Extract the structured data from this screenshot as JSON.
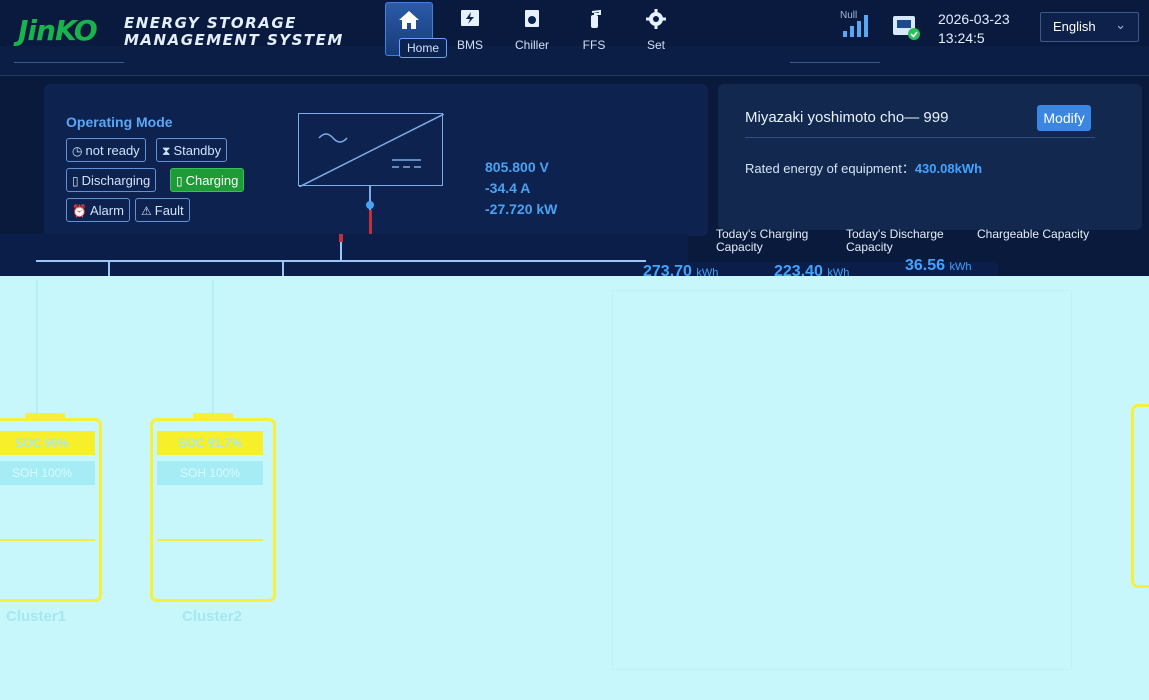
{
  "header": {
    "logo": "JinKO",
    "title_line1": "ENERGY STORAGE",
    "title_line2": "MANAGEMENT SYSTEM",
    "nav": [
      {
        "label": "Home",
        "icon": "home-icon",
        "active": true
      },
      {
        "label": "BMS",
        "icon": "bms-icon",
        "active": false
      },
      {
        "label": "Chiller",
        "icon": "chiller-icon",
        "active": false
      },
      {
        "label": "FFS",
        "icon": "fire-extinguisher-icon",
        "active": false
      },
      {
        "label": "Set",
        "icon": "gear-icon",
        "active": false
      }
    ],
    "signal_label": "Null",
    "date": "2026-03-23",
    "time": "13:24:5",
    "language": "English"
  },
  "operating": {
    "title": "Operating Mode",
    "modes": [
      {
        "label": "not ready",
        "icon": "clock-icon",
        "active": false
      },
      {
        "label": "Standby",
        "icon": "hourglass-icon",
        "active": false
      },
      {
        "label": "Discharging",
        "icon": "battery-discharge-icon",
        "active": false
      },
      {
        "label": "Charging",
        "icon": "battery-charge-icon",
        "active": true
      },
      {
        "label": "Alarm",
        "icon": "alarm-icon",
        "active": false
      },
      {
        "label": "Fault",
        "icon": "warning-icon",
        "active": false
      }
    ],
    "voltage": "805.800 V",
    "current": "-34.4 A",
    "power": "-27.720 kW"
  },
  "station": {
    "name": "Miyazaki yoshimoto cho— 999",
    "modify_label": "Modify",
    "rated_label": "Rated energy of equipment：",
    "rated_value": "430.08kWh",
    "stats": [
      {
        "head": "Today's Charging Capacity",
        "value": "273.70",
        "unit": "kWh"
      },
      {
        "head": "Today's Discharge Capacity",
        "value": "223.40",
        "unit": "kWh"
      },
      {
        "head": "Chargeable Capacity",
        "value": "36.56",
        "unit": "kWh"
      }
    ]
  },
  "clusters": [
    {
      "soc": "SOC 90%",
      "soh": "SOH 100%",
      "name": "Cluster1"
    },
    {
      "soc": "SOC 91.7%",
      "soh": "SOH 100%",
      "name": "Cluster2"
    }
  ],
  "colors": {
    "accent": "#3fa4ff",
    "charging": "#1e9b36",
    "cluster_border": "#f7f03a",
    "lower_background": "#c7f6fb"
  }
}
